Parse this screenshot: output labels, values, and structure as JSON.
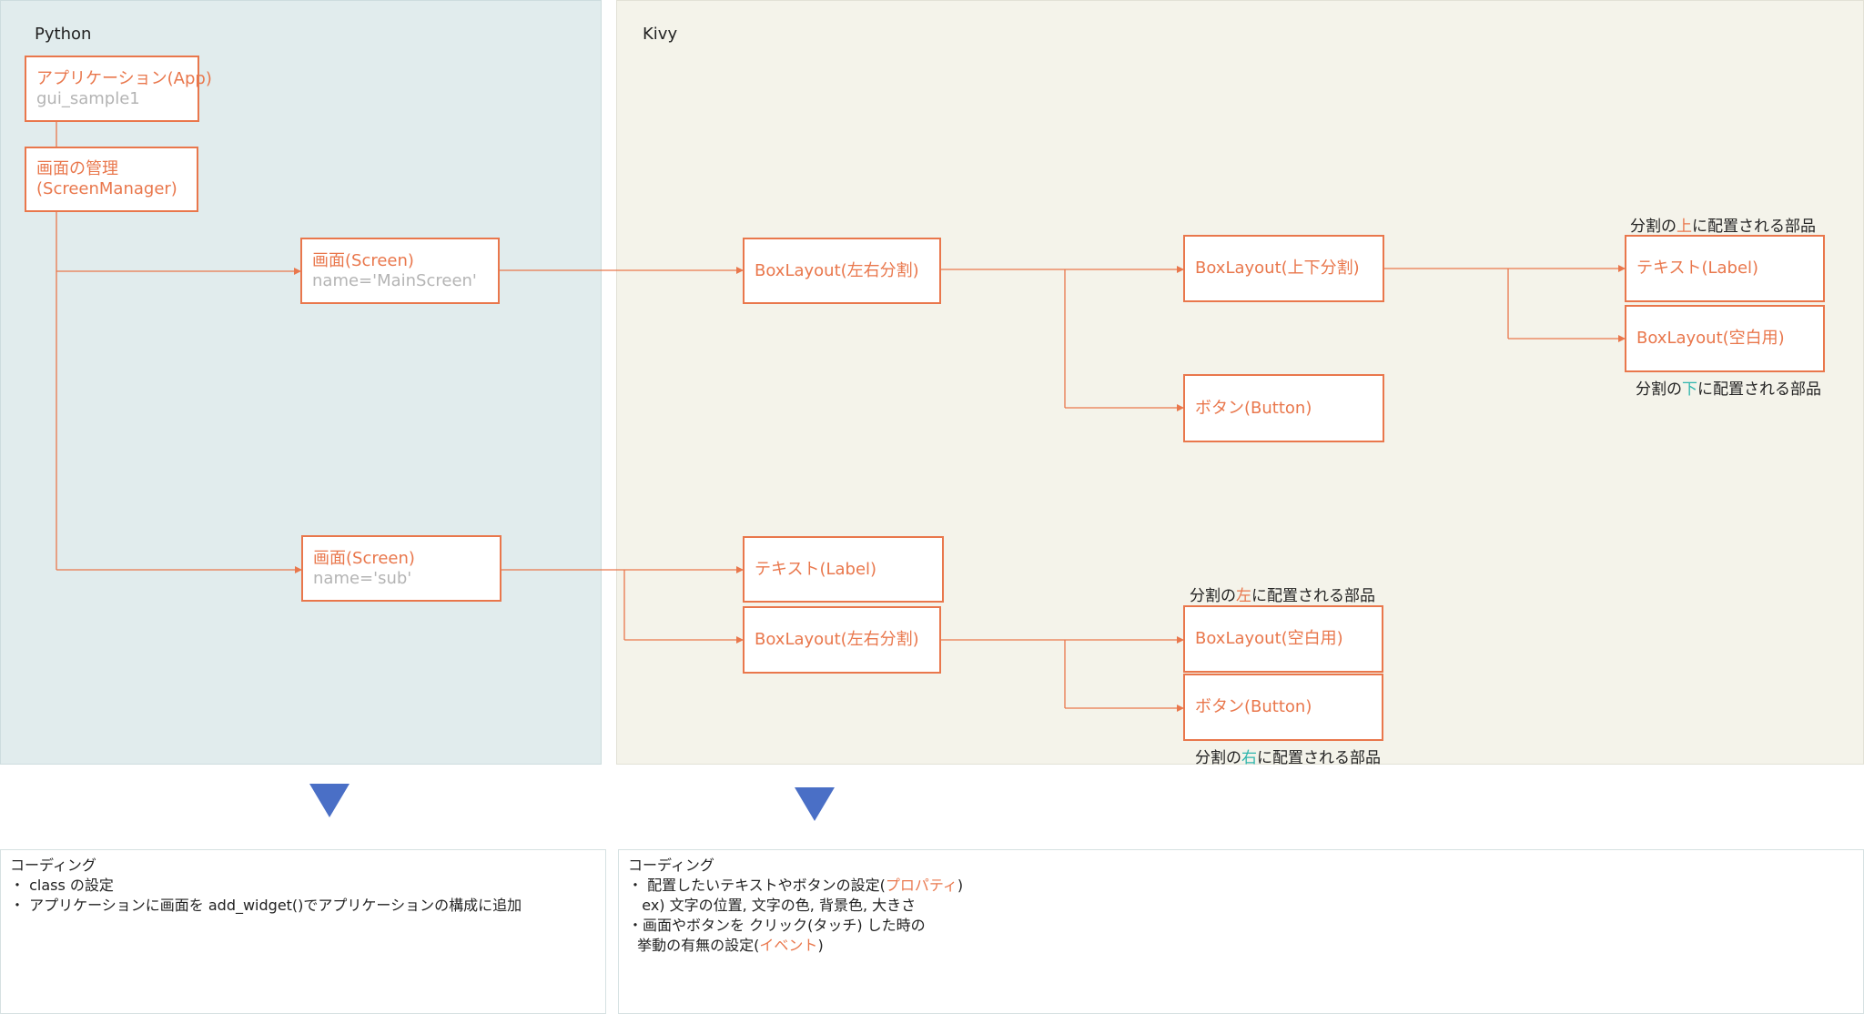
{
  "panels": {
    "python": {
      "label": "Python"
    },
    "kivy": {
      "label": "Kivy"
    }
  },
  "nodes": {
    "app": {
      "title": "アプリケーション(App)",
      "sub": "gui_sample1"
    },
    "manager": {
      "title": "画面の管理",
      "sub": "(ScreenManager)"
    },
    "screen_main": {
      "title": "画面(Screen)",
      "sub": "name='MainScreen'"
    },
    "screen_sub": {
      "title": "画面(Screen)",
      "sub": "name='sub'"
    },
    "main_boxlayout_lr": {
      "title": "BoxLayout(左右分割)"
    },
    "main_boxlayout_ud": {
      "title": "BoxLayout(上下分割)"
    },
    "main_button": {
      "title": "ボタン(Button)"
    },
    "main_label": {
      "title": "テキスト(Label)"
    },
    "main_boxlayout_blank": {
      "title": "BoxLayout(空白用)"
    },
    "sub_label": {
      "title": "テキスト(Label)"
    },
    "sub_boxlayout_lr": {
      "title": "BoxLayout(左右分割)"
    },
    "sub_boxlayout_blank": {
      "title": "BoxLayout(空白用)"
    },
    "sub_button": {
      "title": "ボタン(Button)"
    }
  },
  "captions": {
    "top_part": {
      "pre": "分割の",
      "hl": "上",
      "post": "に配置される部品"
    },
    "bottom_part": {
      "pre": "分割の",
      "hl": "下",
      "post": "に配置される部品"
    },
    "left_part": {
      "pre": "分割の",
      "hl": "左",
      "post": "に配置される部品"
    },
    "right_part": {
      "pre": "分割の",
      "hl": "右",
      "post": "に配置される部品"
    }
  },
  "notes": {
    "python": {
      "heading": "コーディング",
      "line1": "・ class の設定",
      "line2": "・ アプリケーションに画面を add_widget()でアプリケーションの構成に追加"
    },
    "kivy": {
      "heading": "コーディング",
      "line1_pre": "・ 配置したいテキストやボタンの設定(",
      "line1_hl": "プロパティ",
      "line1_post": ")",
      "line2": "   ex) 文字の位置, 文字の色, 背景色, 大きさ",
      "line3": "・画面やボタンを クリック(タッチ) した時の",
      "line4_pre": "  挙動の有無の設定(",
      "line4_hl": "イベント",
      "line4_post": ")"
    }
  },
  "colors": {
    "accent": "#e9774c",
    "arrow_blue": "#4a6fc6",
    "highlight_teal": "#2eb5ad",
    "python_bg": "#e1eced",
    "kivy_bg": "#f4f3ea"
  }
}
